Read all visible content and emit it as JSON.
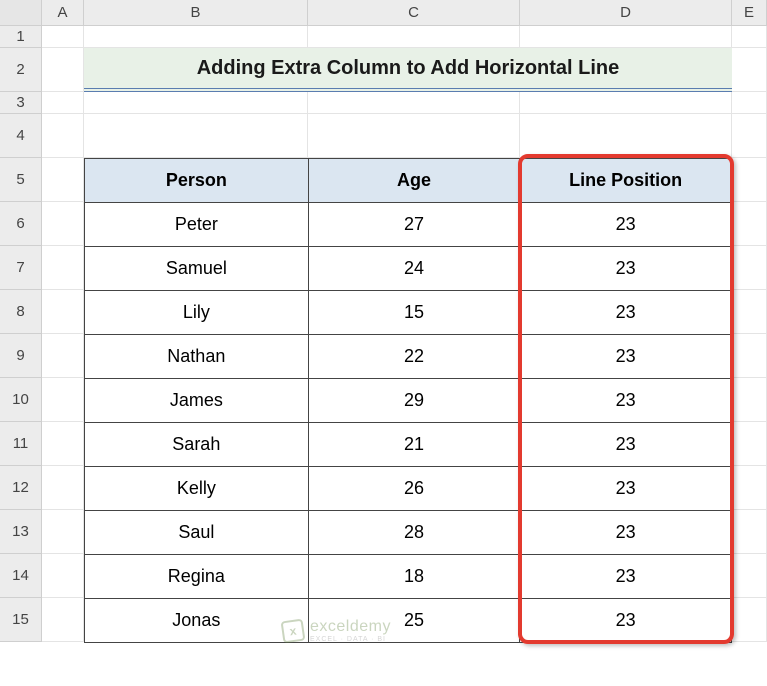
{
  "columns": [
    "A",
    "B",
    "C",
    "D",
    "E"
  ],
  "rows": [
    "1",
    "2",
    "3",
    "4",
    "5",
    "6",
    "7",
    "8",
    "9",
    "10",
    "11",
    "12",
    "13",
    "14",
    "15"
  ],
  "title": "Adding Extra Column to Add Horizontal Line",
  "table": {
    "headers": [
      "Person",
      "Age",
      "Line Position"
    ],
    "data": [
      {
        "person": "Peter",
        "age": "27",
        "line": "23"
      },
      {
        "person": "Samuel",
        "age": "24",
        "line": "23"
      },
      {
        "person": "Lily",
        "age": "15",
        "line": "23"
      },
      {
        "person": "Nathan",
        "age": "22",
        "line": "23"
      },
      {
        "person": "James",
        "age": "29",
        "line": "23"
      },
      {
        "person": "Sarah",
        "age": "21",
        "line": "23"
      },
      {
        "person": "Kelly",
        "age": "26",
        "line": "23"
      },
      {
        "person": "Saul",
        "age": "28",
        "line": "23"
      },
      {
        "person": "Regina",
        "age": "18",
        "line": "23"
      },
      {
        "person": "Jonas",
        "age": "25",
        "line": "23"
      }
    ]
  },
  "watermark": {
    "main": "exceldemy",
    "sub": "EXCEL · DATA · BI"
  }
}
